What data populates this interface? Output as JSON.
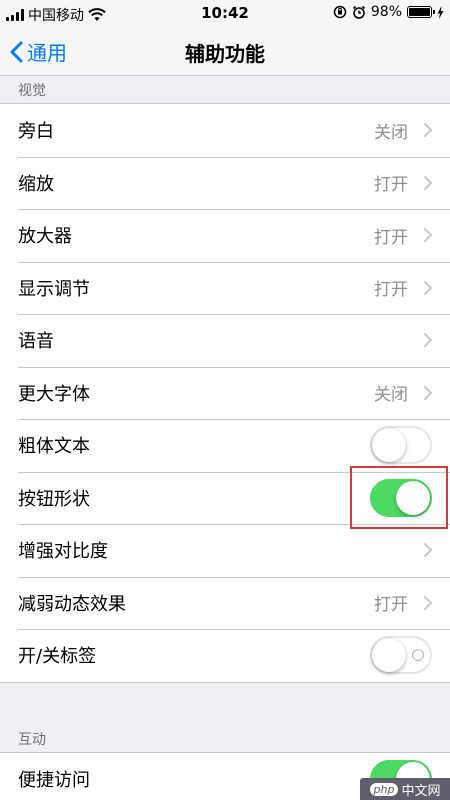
{
  "status_bar": {
    "carrier": "中国移动",
    "time": "10:42",
    "battery": "98%",
    "battery_level": 0.98
  },
  "nav": {
    "back_label": "通用",
    "title": "辅助功能"
  },
  "sections": {
    "vision": {
      "header": "视觉",
      "rows": [
        {
          "label": "旁白",
          "value": "关闭"
        },
        {
          "label": "缩放",
          "value": "打开"
        },
        {
          "label": "放大器",
          "value": "打开"
        },
        {
          "label": "显示调节",
          "value": "打开"
        },
        {
          "label": "语音",
          "value": ""
        },
        {
          "label": "更大字体",
          "value": "关闭"
        },
        {
          "label": "粗体文本",
          "toggle": false
        },
        {
          "label": "按钮形状",
          "toggle": true
        },
        {
          "label": "增强对比度",
          "value": ""
        },
        {
          "label": "减弱动态效果",
          "value": "打开"
        },
        {
          "label": "开/关标签",
          "toggle": false
        }
      ]
    },
    "interaction": {
      "header": "互动",
      "rows": [
        {
          "label": "便捷访问",
          "toggle": true
        }
      ]
    }
  },
  "watermark": {
    "logo": "php",
    "text": "中文网"
  },
  "colors": {
    "accent": "#007aff",
    "toggle_on": "#4cd964",
    "highlight": "#d03c3c"
  }
}
